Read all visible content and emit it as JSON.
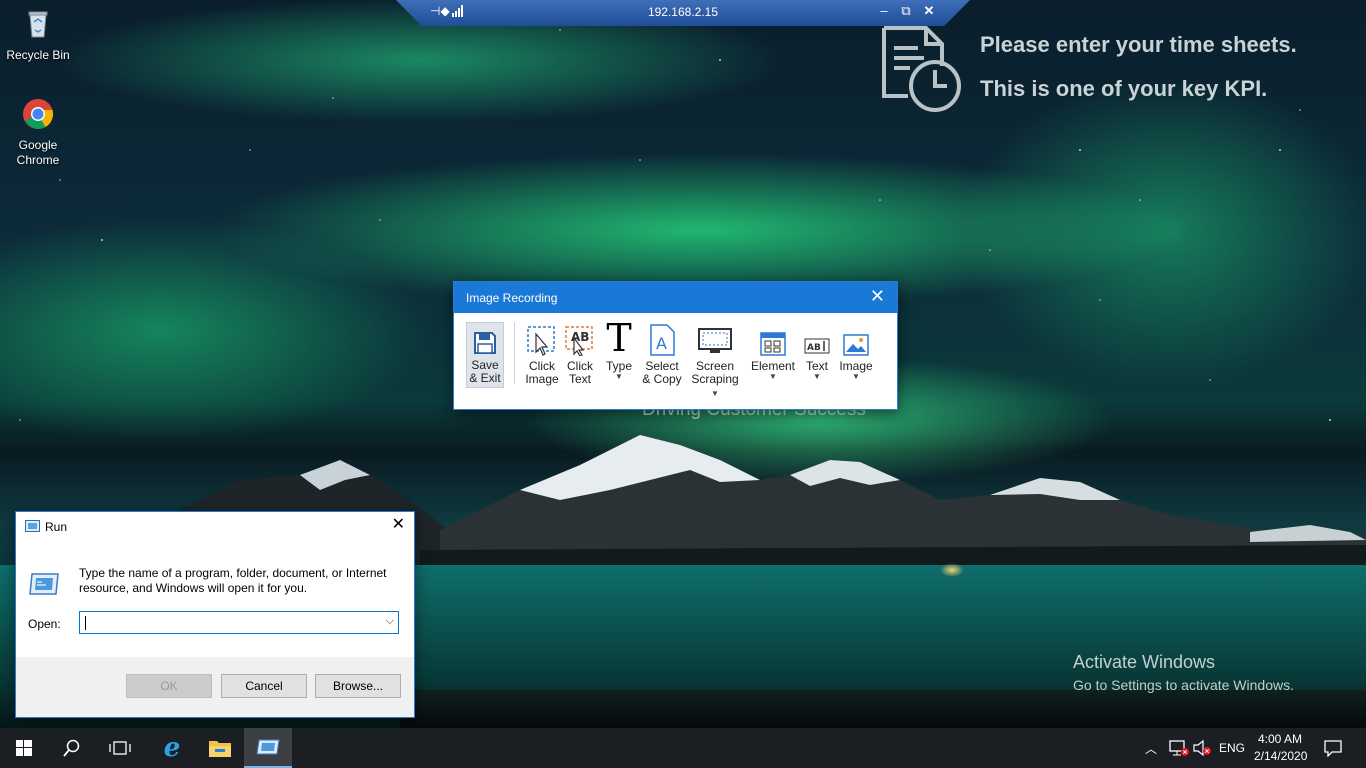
{
  "desktop": {
    "icons": [
      {
        "label": "Recycle Bin",
        "icon": "recycle-bin-icon"
      },
      {
        "label": "Google Chrome",
        "icon": "chrome-icon"
      }
    ],
    "caption": "Driving Customer Success"
  },
  "rdp": {
    "address": "192.168.2.15",
    "icons": [
      "pin-icon",
      "signal-icon",
      "minimize-icon",
      "restore-icon",
      "close-icon"
    ]
  },
  "timesheet": {
    "line1": "Please enter your time sheets.",
    "line2": "This is one of your key KPI."
  },
  "activation": {
    "title": "Activate Windows",
    "subtitle": "Go to Settings to activate Windows."
  },
  "image_recording": {
    "title": "Image Recording",
    "tools": [
      {
        "line1": "Save",
        "line2": "& Exit",
        "icon": "floppy-disk-icon"
      },
      {
        "line1": "Click",
        "line2": "Image",
        "icon": "click-image-icon"
      },
      {
        "line1": "Click",
        "line2": "Text",
        "icon": "click-text-icon"
      },
      {
        "line1": "Type",
        "line2": "",
        "icon": "type-icon"
      },
      {
        "line1": "Select",
        "line2": "& Copy",
        "icon": "select-copy-icon"
      },
      {
        "line1": "Screen",
        "line2": "Scraping",
        "icon": "screen-scraping-icon"
      },
      {
        "line1": "Element",
        "line2": "",
        "icon": "element-icon"
      },
      {
        "line1": "Text",
        "line2": "",
        "icon": "text-icon"
      },
      {
        "line1": "Image",
        "line2": "",
        "icon": "image-icon"
      }
    ]
  },
  "run_dialog": {
    "title": "Run",
    "description": "Type the name of a program, folder, document, or Internet resource, and Windows will open it for you.",
    "open_label": "Open:",
    "open_value": "",
    "ok": "OK",
    "cancel": "Cancel",
    "browse": "Browse..."
  },
  "taskbar": {
    "items": [
      "start-icon",
      "search-icon",
      "task-view-icon",
      "internet-explorer-icon",
      "file-explorer-icon",
      "run-app-icon"
    ],
    "language": "ENG",
    "time": "4:00 AM",
    "date": "2/14/2020"
  },
  "colors": {
    "accent": "#1a78d6",
    "taskbar": "#0a0e12"
  }
}
